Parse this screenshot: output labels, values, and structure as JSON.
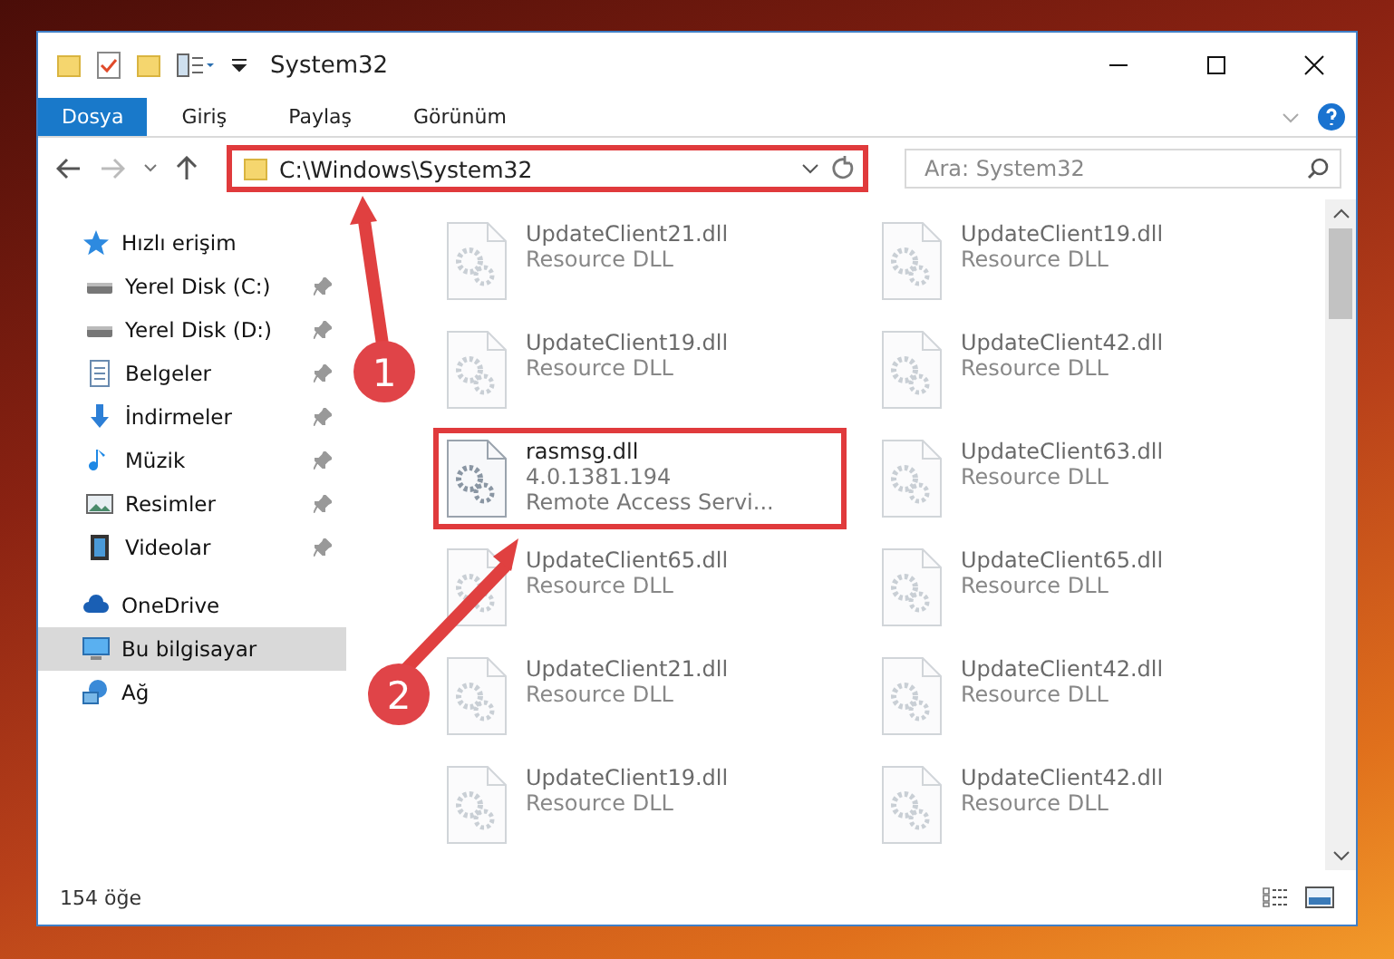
{
  "window": {
    "title": "System32"
  },
  "ribbon_tabs": [
    {
      "label": "Dosya",
      "selected": true
    },
    {
      "label": "Giriş",
      "selected": false
    },
    {
      "label": "Paylaş",
      "selected": false
    },
    {
      "label": "Görünüm",
      "selected": false
    }
  ],
  "address_bar": {
    "path": "C:\\Windows\\System32",
    "highlighted": true
  },
  "search": {
    "placeholder": "Ara: System32"
  },
  "sidebar": {
    "items": [
      {
        "label": "Hızlı erişim",
        "selected": false,
        "children": [
          {
            "label": "Yerel Disk (C:)",
            "pinned": true,
            "selected": false
          },
          {
            "label": "Yerel Disk (D:)",
            "pinned": true,
            "selected": false
          },
          {
            "label": "Belgeler",
            "pinned": true,
            "selected": false
          },
          {
            "label": "İndirmeler",
            "pinned": true,
            "selected": false
          },
          {
            "label": "Müzik",
            "pinned": true,
            "selected": false
          },
          {
            "label": "Resimler",
            "pinned": true,
            "selected": false
          },
          {
            "label": "Videolar",
            "pinned": true,
            "selected": false
          }
        ]
      },
      {
        "label": "OneDrive",
        "selected": false
      },
      {
        "label": "Bu bilgisayar",
        "selected": true
      },
      {
        "label": "Ağ",
        "selected": false
      }
    ]
  },
  "files": [
    {
      "name": "UpdateClient21.dll",
      "details": [
        "Resource DLL"
      ],
      "highlighted": false
    },
    {
      "name": "UpdateClient19.dll",
      "details": [
        "Resource DLL"
      ],
      "highlighted": false
    },
    {
      "name": "UpdateClient19.dll",
      "details": [
        "Resource DLL"
      ],
      "highlighted": false
    },
    {
      "name": "UpdateClient42.dll",
      "details": [
        "Resource DLL"
      ],
      "highlighted": false
    },
    {
      "name": "rasmsg.dll",
      "details": [
        "4.0.1381.194",
        "Remote Access Servi..."
      ],
      "highlighted": true
    },
    {
      "name": "UpdateClient63.dll",
      "details": [
        "Resource DLL"
      ],
      "highlighted": false
    },
    {
      "name": "UpdateClient65.dll",
      "details": [
        "Resource DLL"
      ],
      "highlighted": false
    },
    {
      "name": "UpdateClient65.dll",
      "details": [
        "Resource DLL"
      ],
      "highlighted": false
    },
    {
      "name": "UpdateClient21.dll",
      "details": [
        "Resource DLL"
      ],
      "highlighted": false
    },
    {
      "name": "UpdateClient42.dll",
      "details": [
        "Resource DLL"
      ],
      "highlighted": false
    },
    {
      "name": "UpdateClient19.dll",
      "details": [
        "Resource DLL"
      ],
      "highlighted": false
    },
    {
      "name": "UpdateClient42.dll",
      "details": [
        "Resource DLL"
      ],
      "highlighted": false
    }
  ],
  "status_bar": {
    "item_count": "154 öğe"
  },
  "callouts": [
    {
      "label": "1"
    },
    {
      "label": "2"
    }
  ]
}
